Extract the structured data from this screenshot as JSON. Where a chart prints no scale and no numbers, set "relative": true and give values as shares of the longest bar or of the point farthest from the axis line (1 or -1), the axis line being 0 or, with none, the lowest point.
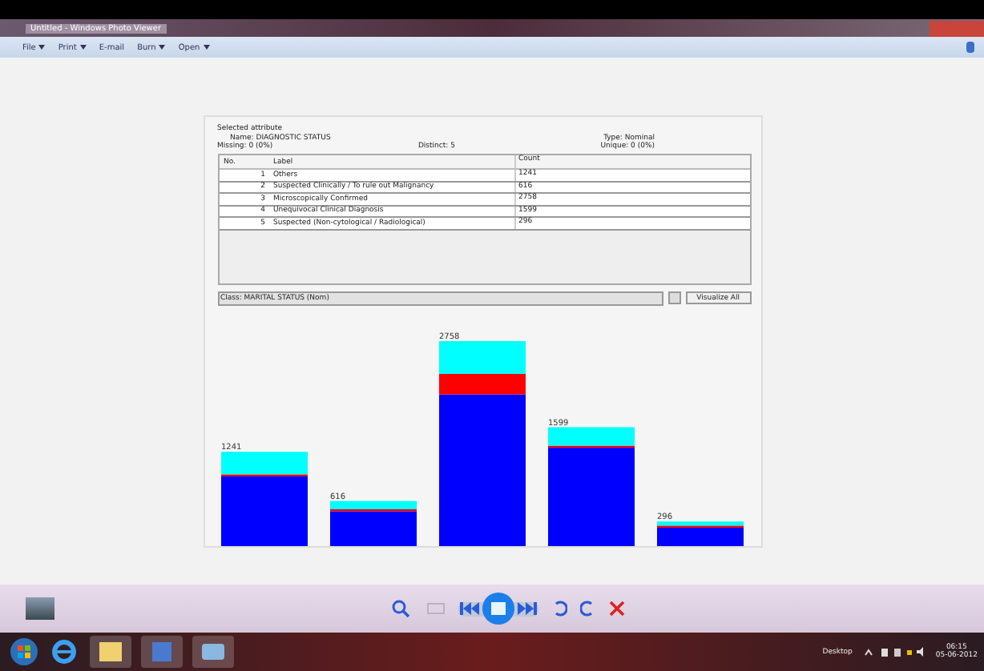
{
  "window": {
    "title": "Untitled - Windows Photo Viewer"
  },
  "menu": [
    {
      "label": "File",
      "dropdown": true
    },
    {
      "label": "Print",
      "dropdown": true
    },
    {
      "label": "E-mail",
      "dropdown": false
    },
    {
      "label": "Burn",
      "dropdown": true
    },
    {
      "label": "Open",
      "dropdown": true
    }
  ],
  "attribute": {
    "heading": "Selected attribute",
    "name": "Name: DIAGNOSTIC STATUS",
    "type": "Type: Nominal",
    "missing": "Missing: 0 (0%)",
    "distinct": "Distinct: 5",
    "unique": "Unique: 0 (0%)"
  },
  "table": {
    "columns": [
      "No.",
      "Label",
      "Count"
    ],
    "rows": [
      {
        "no": "1",
        "label": "Others",
        "count": "1241"
      },
      {
        "no": "2",
        "label": "Suspected Clinically / To rule out Malignancy",
        "count": "616"
      },
      {
        "no": "3",
        "label": "Microscopically Confirmed",
        "count": "2758"
      },
      {
        "no": "4",
        "label": "Unequivocal Clinical Diagnosis",
        "count": "1599"
      },
      {
        "no": "5",
        "label": "Suspected (Non-cytological / Radiological)",
        "count": "296"
      }
    ]
  },
  "class_select": {
    "value": "Class: MARITAL STATUS (Nom)"
  },
  "visualize_button": "Visualize All",
  "chart_data": {
    "type": "bar",
    "stacked": true,
    "relative": true,
    "series": [
      {
        "color": "#0000ff",
        "values": [
          0.34,
          0.17,
          0.74,
          0.48,
          0.09
        ]
      },
      {
        "color": "#ff0000",
        "values": [
          0.01,
          0.01,
          0.1,
          0.01,
          0.01
        ]
      },
      {
        "color": "#00ffff",
        "values": [
          0.11,
          0.04,
          0.16,
          0.09,
          0.02
        ]
      }
    ],
    "value_labels": [
      "1241",
      "616",
      "2758",
      "1599",
      "296"
    ]
  },
  "taskbar": {
    "desktop": "Desktop",
    "time": "06:15",
    "date": "05-06-2012"
  }
}
